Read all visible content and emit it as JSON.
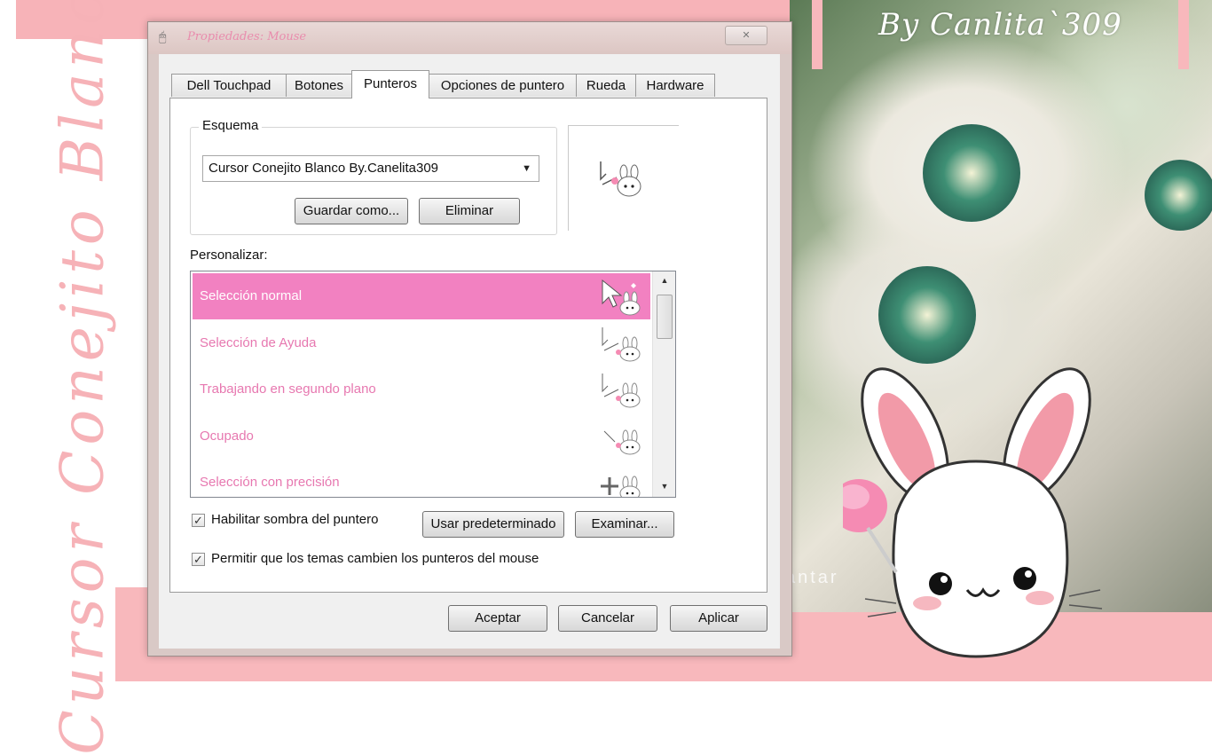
{
  "decor": {
    "side_title": "Cursor Conejito Blanco",
    "byline": "By Canlita`309",
    "watermark": "antar"
  },
  "window": {
    "title": "Propiedades: Mouse",
    "close_symbol": "✕"
  },
  "tabs": [
    {
      "label": "Dell Touchpad"
    },
    {
      "label": "Botones"
    },
    {
      "label": "Punteros"
    },
    {
      "label": "Opciones de puntero"
    },
    {
      "label": "Rueda"
    },
    {
      "label": "Hardware"
    }
  ],
  "scheme": {
    "group_label": "Esquema",
    "selected": "Cursor Conejito Blanco By.Canelita309",
    "save_as_label": "Guardar como...",
    "delete_label": "Eliminar"
  },
  "customize": {
    "label": "Personalizar:",
    "items": [
      {
        "label": "Selección normal"
      },
      {
        "label": "Selección de Ayuda"
      },
      {
        "label": "Trabajando en segundo plano"
      },
      {
        "label": "Ocupado"
      },
      {
        "label": "Selección con precisión"
      }
    ],
    "selected_index": 0
  },
  "options": {
    "shadow_label": "Habilitar sombra del puntero",
    "themes_label": "Permitir que los temas cambien los punteros del mouse",
    "use_default_label": "Usar predeterminado",
    "browse_label": "Examinar..."
  },
  "footer": {
    "ok_label": "Aceptar",
    "cancel_label": "Cancelar",
    "apply_label": "Aplicar"
  },
  "colors": {
    "accent_pink": "#f281c1",
    "item_text_pink": "#e778b0",
    "decor_pink": "#f8b8bc"
  }
}
